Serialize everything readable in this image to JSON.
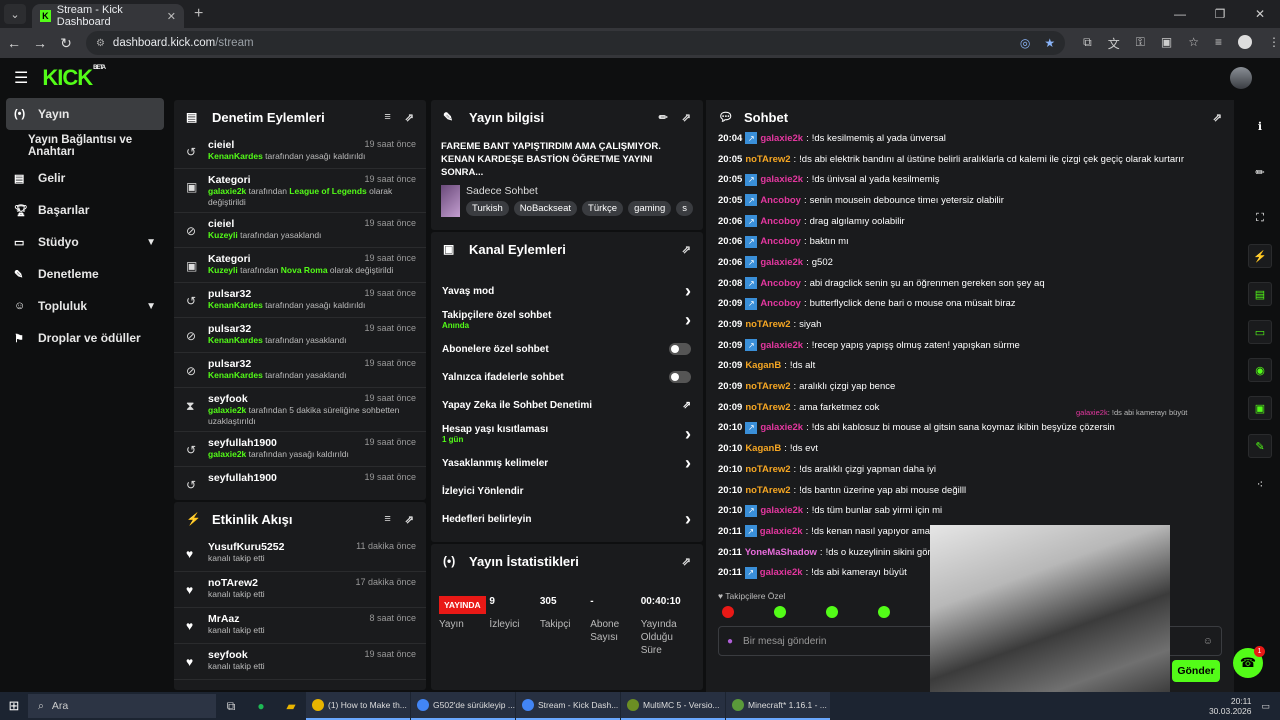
{
  "browser": {
    "tab_title": "Stream - Kick Dashboard",
    "url_site": "dashboard.kick.com",
    "url_path": "/stream"
  },
  "topbar": {
    "logo": "KICK",
    "beta": "BETA"
  },
  "sidebar": {
    "items": [
      {
        "label": "Yayın",
        "icon": "broadcast-icon"
      },
      {
        "label": "Yayın Bağlantısı ve Anahtarı"
      },
      {
        "label": "Gelir",
        "icon": "dollar-icon"
      },
      {
        "label": "Başarılar",
        "icon": "trophy-icon"
      },
      {
        "label": "Stüdyo",
        "icon": "studio-icon"
      },
      {
        "label": "Denetleme",
        "icon": "wrench-icon"
      },
      {
        "label": "Topluluk",
        "icon": "people-icon"
      },
      {
        "label": "Droplar ve ödüller",
        "icon": "gift-icon"
      }
    ]
  },
  "moderation": {
    "title": "Denetim Eylemleri",
    "items": [
      {
        "user": "cieiel",
        "time": "19 saat önce",
        "pre": "KenanKardes",
        "post": " tarafından yasağı kaldırıldı",
        "icon": "unban-icon"
      },
      {
        "user": "Kategori",
        "time": "19 saat önce",
        "pre": "galaxie2k",
        "mid": " tarafından ",
        "hl": "League of Legends",
        "post": " olarak değiştirildi",
        "icon": "category-icon"
      },
      {
        "user": "cieiel",
        "time": "19 saat önce",
        "pre": "Kuzeyli",
        "post": " tarafından yasaklandı",
        "icon": "ban-icon"
      },
      {
        "user": "Kategori",
        "time": "19 saat önce",
        "pre": "Kuzeyli",
        "mid": " tarafından ",
        "hl": "Nova Roma",
        "post": " olarak değiştirildi",
        "icon": "category-icon"
      },
      {
        "user": "pulsar32",
        "time": "19 saat önce",
        "pre": "KenanKardes",
        "post": " tarafından yasağı kaldırıldı",
        "icon": "unban-icon"
      },
      {
        "user": "pulsar32",
        "time": "19 saat önce",
        "pre": "KenanKardes",
        "post": " tarafından yasaklandı",
        "icon": "ban-icon"
      },
      {
        "user": "pulsar32",
        "time": "19 saat önce",
        "pre": "KenanKardes",
        "post": " tarafından yasaklandı",
        "icon": "ban-icon"
      },
      {
        "user": "seyfook",
        "time": "19 saat önce",
        "pre": "galaxie2k",
        "post": " tarafından 5 dakika süreliğine sohbetten uzaklaştırıldı",
        "icon": "timeout-icon"
      },
      {
        "user": "seyfullah1900",
        "time": "19 saat önce",
        "pre": "galaxie2k",
        "post": " tarafından yasağı kaldırıldı",
        "icon": "unban-icon"
      },
      {
        "user": "seyfullah1900",
        "time": "19 saat önce",
        "pre": "",
        "post": "",
        "icon": "unban-icon"
      }
    ]
  },
  "activity": {
    "title": "Etkinlik Akışı",
    "items": [
      {
        "user": "YusufKuru5252",
        "desc": "kanalı takip etti",
        "time": "11 dakika önce"
      },
      {
        "user": "noTArew2",
        "desc": "kanalı takip etti",
        "time": "17 dakika önce"
      },
      {
        "user": "MrAaz",
        "desc": "kanalı takip etti",
        "time": "8 saat önce"
      },
      {
        "user": "seyfook",
        "desc": "kanalı takip etti",
        "time": "19 saat önce"
      }
    ]
  },
  "stream_info": {
    "title": "Yayın bilgisi",
    "stream_title": "FAREME BANT YAPIŞTIRDIM AMA ÇALIŞMIYOR. KENAN KARDEŞE BASTİON ÖĞRETME YAYINI SONRA...",
    "category": "Sadece Sohbet",
    "tags": [
      "Turkish",
      "NoBackseat",
      "Türkçe",
      "gaming",
      "s"
    ]
  },
  "channel_actions": {
    "title": "Kanal Eylemleri",
    "items": [
      {
        "label": "Yavaş mod",
        "type": "chev"
      },
      {
        "label": "Takipçilere özel sohbet",
        "sub": "Anında",
        "type": "chev"
      },
      {
        "label": "Abonelere özel sohbet",
        "type": "toggle"
      },
      {
        "label": "Yalnızca ifadelerle sohbet",
        "type": "toggle"
      },
      {
        "label": "Yapay Zeka ile Sohbet Denetimi",
        "type": "ext"
      },
      {
        "label": "Hesap yaşı kısıtlaması",
        "sub": "1 gün",
        "type": "chev"
      },
      {
        "label": "Yasaklanmış kelimeler",
        "type": "chev"
      },
      {
        "label": "İzleyici Yönlendir",
        "type": "none"
      },
      {
        "label": "Hedefleri belirleyin",
        "type": "chev"
      }
    ]
  },
  "stats": {
    "title": "Yayın İstatistikleri",
    "live": "YAYINDA",
    "live_label": "Yayın",
    "cols": [
      {
        "v": "9",
        "l": "İzleyici"
      },
      {
        "v": "305",
        "l": "Takipçi"
      },
      {
        "v": "-",
        "l": "Abone Sayısı"
      },
      {
        "v": "00:40:10",
        "l": "Yayında Olduğu Süre"
      }
    ]
  },
  "chat": {
    "title": "Sohbet",
    "messages": [
      {
        "t": "20:04",
        "b": true,
        "u": "galaxie2k",
        "c": "#e3379f",
        "m": "!ds kesilmemiş al yada ünversal"
      },
      {
        "t": "20:05",
        "b": false,
        "u": "noTArew2",
        "c": "#f5a623",
        "m": "!ds abi elektrik bandını al üstüne belirli aralıklarla cd kalemi ile çizgi çek geçiç olarak kurtarır"
      },
      {
        "t": "20:05",
        "b": true,
        "u": "galaxie2k",
        "c": "#e3379f",
        "m": "!ds ünivsal al yada kesilmemiş"
      },
      {
        "t": "20:05",
        "b": true,
        "u": "Ancoboy",
        "c": "#e3379f",
        "m": "senin mousein debounce timeı yetersiz olabilir"
      },
      {
        "t": "20:06",
        "b": true,
        "u": "Ancoboy",
        "c": "#e3379f",
        "m": "drag algılamıy oolabilir"
      },
      {
        "t": "20:06",
        "b": true,
        "u": "Ancoboy",
        "c": "#e3379f",
        "m": "baktın mı"
      },
      {
        "t": "20:06",
        "b": true,
        "u": "galaxie2k",
        "c": "#e3379f",
        "m": "g502"
      },
      {
        "t": "20:08",
        "b": true,
        "u": "Ancoboy",
        "c": "#e3379f",
        "m": "abi dragclick senin şu an öğrenmen gereken son şey aq"
      },
      {
        "t": "20:09",
        "b": true,
        "u": "Ancoboy",
        "c": "#e3379f",
        "m": "butterflyclick dene bari o mouse ona müsait biraz"
      },
      {
        "t": "20:09",
        "b": false,
        "u": "noTArew2",
        "c": "#f5a623",
        "m": "siyah"
      },
      {
        "t": "20:09",
        "b": true,
        "u": "galaxie2k",
        "c": "#e3379f",
        "m": "!recep yapış yapışş olmuş zaten! yapışkan sürme"
      },
      {
        "t": "20:09",
        "b": false,
        "u": "KaganB",
        "c": "#f5a623",
        "m": "!ds alt"
      },
      {
        "t": "20:09",
        "b": false,
        "u": "noTArew2",
        "c": "#f5a623",
        "m": "aralıklı çizgi yap bence"
      },
      {
        "t": "20:09",
        "b": false,
        "u": "noTArew2",
        "c": "#f5a623",
        "m": "ama farketmez cok"
      },
      {
        "t": "20:10",
        "b": true,
        "u": "galaxie2k",
        "c": "#e3379f",
        "m": "!ds abi kablosuz bi mouse al gitsin sana koymaz ikibin beşyüze çözersin"
      },
      {
        "t": "20:10",
        "b": false,
        "u": "KaganB",
        "c": "#f5a623",
        "m": "!ds evt"
      },
      {
        "t": "20:10",
        "b": false,
        "u": "noTArew2",
        "c": "#f5a623",
        "m": "!ds aralıklı çizgi yapman daha iyi"
      },
      {
        "t": "20:10",
        "b": false,
        "u": "noTArew2",
        "c": "#f5a623",
        "m": "!ds bantın üzerine yap abi mouse değilll"
      },
      {
        "t": "20:10",
        "b": true,
        "u": "galaxie2k",
        "c": "#e3379f",
        "m": "!ds tüm bunlar sab yirmi için mi"
      },
      {
        "t": "20:11",
        "b": true,
        "u": "galaxie2k",
        "c": "#e3379f",
        "m": "!ds kenan nasıl yapıyor ama"
      },
      {
        "t": "20:11",
        "b": false,
        "u": "YoneMaShadow",
        "c": "#e86cdb",
        "m": "!ds o kuzeylinin sikini gördün"
      },
      {
        "t": "20:11",
        "b": true,
        "u": "galaxie2k",
        "c": "#e3379f",
        "m": "!ds abi kamerayı büyüt"
      }
    ],
    "pinned": {
      "user": "galaxie2k",
      "text": ": !ds abi kamerayı büyüt"
    },
    "follow_only": "Takipçilere Özel",
    "placeholder": "Bir mesaj gönderin",
    "send": "Gönder"
  },
  "taskbar": {
    "search": "Ara",
    "apps": [
      "(1) How to Make th...",
      "G502'de sürükleyip ...",
      "Stream - Kick Dash...",
      "MultiMC 5 - Versio...",
      "Minecraft* 1.16.1 - ..."
    ],
    "time": "20:11",
    "date": "30.03.2026"
  },
  "colors": {
    "accent": "#53fc18",
    "live": "#e91916"
  }
}
